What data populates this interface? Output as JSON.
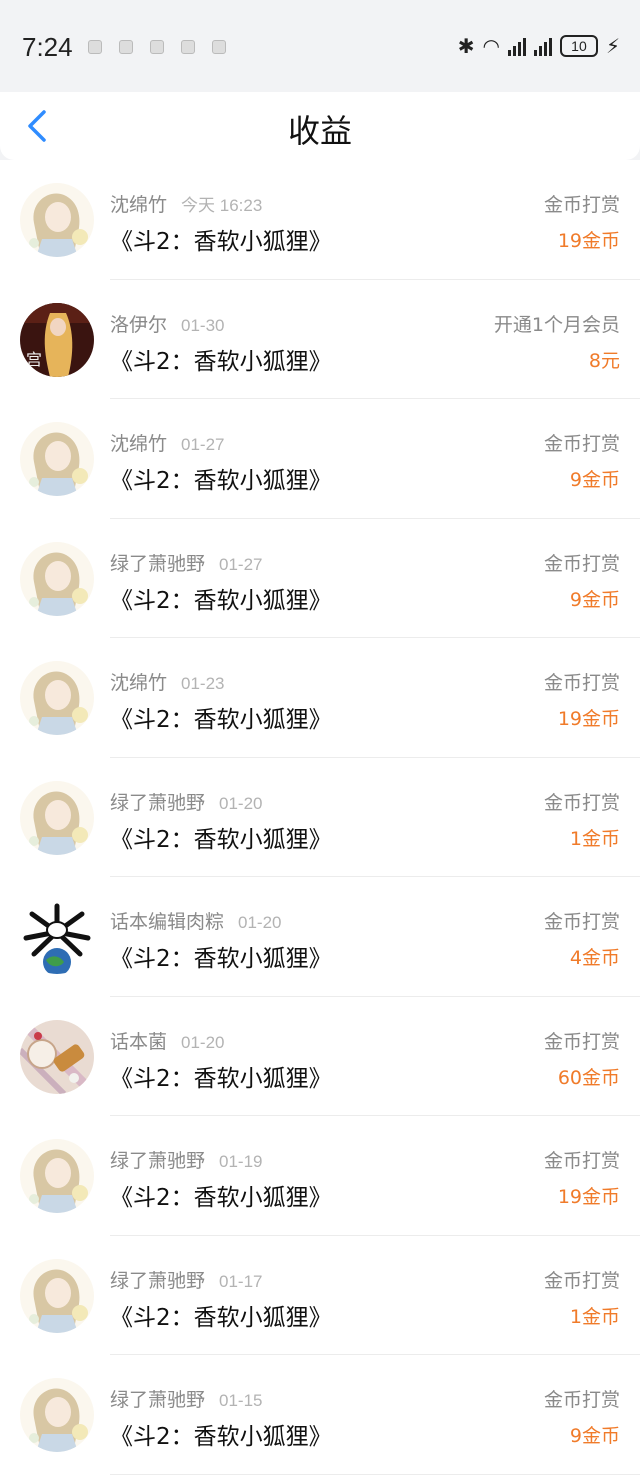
{
  "status_bar": {
    "time": "7:24",
    "battery": "10"
  },
  "header": {
    "title": "收益"
  },
  "records": [
    {
      "name": "沈绵竹",
      "date": "今天 16:23",
      "book": "《斗2：香软小狐狸》",
      "type": "金币打赏",
      "amount": "19金币",
      "avatar": "anime-girl"
    },
    {
      "name": "洛伊尔",
      "date": "01-30",
      "book": "《斗2：香软小狐狸》",
      "type": "开通1个月会员",
      "amount": "8元",
      "avatar": "dark-poster"
    },
    {
      "name": "沈绵竹",
      "date": "01-27",
      "book": "《斗2：香软小狐狸》",
      "type": "金币打赏",
      "amount": "9金币",
      "avatar": "anime-girl"
    },
    {
      "name": "绿了萧驰野",
      "date": "01-27",
      "book": "《斗2：香软小狐狸》",
      "type": "金币打赏",
      "amount": "9金币",
      "avatar": "anime-girl"
    },
    {
      "name": "沈绵竹",
      "date": "01-23",
      "book": "《斗2：香软小狐狸》",
      "type": "金币打赏",
      "amount": "19金币",
      "avatar": "anime-girl"
    },
    {
      "name": "绿了萧驰野",
      "date": "01-20",
      "book": "《斗2：香软小狐狸》",
      "type": "金币打赏",
      "amount": "1金币",
      "avatar": "anime-girl"
    },
    {
      "name": "话本编辑肉粽",
      "date": "01-20",
      "book": "《斗2：香软小狐狸》",
      "type": "金币打赏",
      "amount": "4金币",
      "avatar": "globe-creature"
    },
    {
      "name": "话本菌",
      "date": "01-20",
      "book": "《斗2：香软小狐狸》",
      "type": "金币打赏",
      "amount": "60金币",
      "avatar": "food-photo"
    },
    {
      "name": "绿了萧驰野",
      "date": "01-19",
      "book": "《斗2：香软小狐狸》",
      "type": "金币打赏",
      "amount": "19金币",
      "avatar": "anime-girl"
    },
    {
      "name": "绿了萧驰野",
      "date": "01-17",
      "book": "《斗2：香软小狐狸》",
      "type": "金币打赏",
      "amount": "1金币",
      "avatar": "anime-girl"
    },
    {
      "name": "绿了萧驰野",
      "date": "01-15",
      "book": "《斗2：香软小狐狸》",
      "type": "金币打赏",
      "amount": "9金币",
      "avatar": "anime-girl"
    }
  ],
  "colors": {
    "accent": "#2f8cff",
    "amount": "#f07b2a",
    "muted": "#8a8a8a"
  }
}
